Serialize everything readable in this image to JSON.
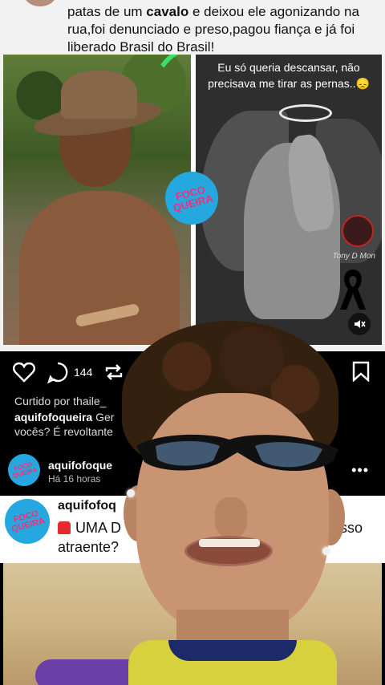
{
  "caption": {
    "part1": "patas de um ",
    "bold": "cavalo",
    "part2": " e deixou ele agonizando na rua,foi denunciado e preso,pagou fiança e já foi liberado Brasil do Brasil!"
  },
  "collage": {
    "right_text": "Eu só queria descansar, não precisava me tirar as pernas..😞",
    "signature": "Tony D Mon",
    "badge_line1": "FOCO",
    "badge_line2": "QUEIRA"
  },
  "post": {
    "comment_count": "144",
    "liked_by": "Curtido por thaile_",
    "caption_user": "aquifofoqueira",
    "caption_rest": " Ger",
    "caption_line2": "vocês? É revoltante",
    "username": "aquifofoque",
    "time": "Há 16 horas",
    "more": "•••"
  },
  "comment": {
    "username": "aquifofoq",
    "text": "UMA D",
    "text_right": "isso",
    "text_line2": "atraente?"
  },
  "icons": {
    "like": "heart-icon",
    "comment": "comment-icon",
    "repost": "repost-icon",
    "save": "bookmark-icon",
    "mute": "muted-speaker-icon"
  },
  "colors": {
    "badge_blue": "#25a7e0",
    "badge_pink": "#ff2a7a",
    "accent_green": "#3be06a"
  }
}
